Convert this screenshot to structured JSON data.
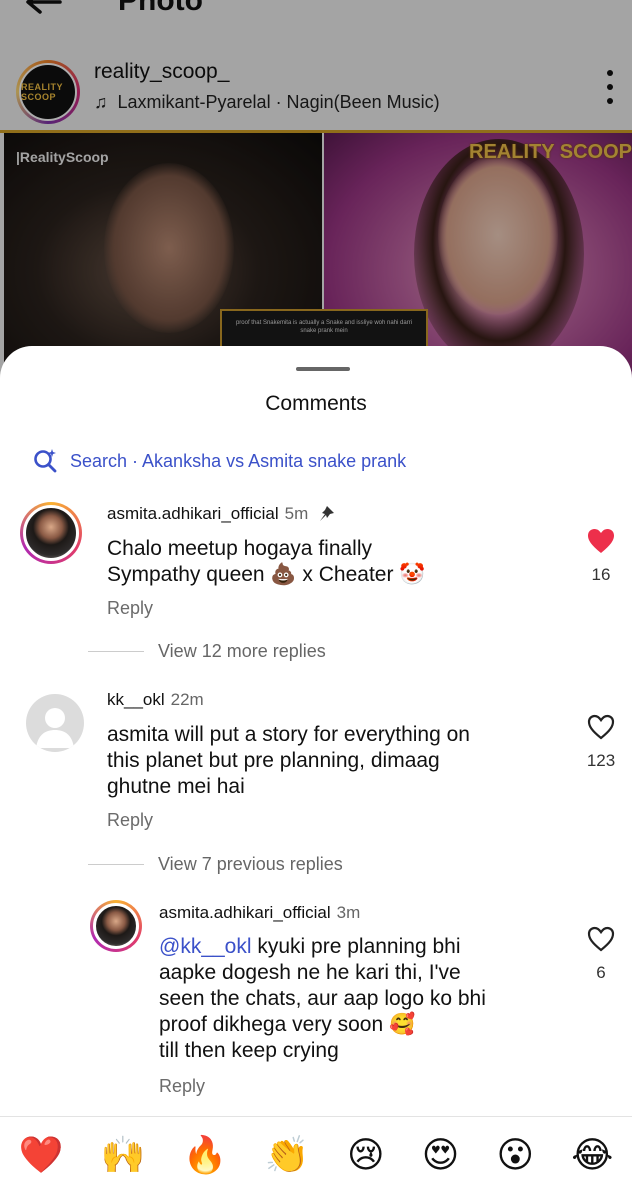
{
  "topbar": {
    "title": "Photo"
  },
  "post": {
    "username": "reality_scoop_",
    "music": "Laxmikant-Pyarelal · Nagin(Been Music)",
    "avatar_logo": "REALITY SCOOP",
    "watermark_left": "|RealityScoop",
    "watermark_right": "REALITY SCOOP",
    "caption_overlay": "proof that Snakemita is actually a Snake and issliye woh nahi darri snake prank mein"
  },
  "comments_sheet": {
    "title": "Comments",
    "search_label": "Search · Akanksha vs Asmita snake prank",
    "comments": [
      {
        "username": "asmita.adhikari_official",
        "time": "5m",
        "pinned": true,
        "text_line1": "Chalo meetup hogaya finally",
        "text_line2": "Sympathy queen 💩 x Cheater 🤡",
        "reply_label": "Reply",
        "likes": "16",
        "liked": true,
        "view_replies": "View 12 more replies"
      },
      {
        "username": "kk__okl",
        "time": "22m",
        "text_line1": "asmita will put a story for everything on",
        "text_line2": "this planet but pre planning, dimaag",
        "text_line3": "ghutne mei hai",
        "reply_label": "Reply",
        "likes": "123",
        "liked": false,
        "view_replies": "View 7 previous replies"
      }
    ],
    "reply": {
      "username": "asmita.adhikari_official",
      "time": "3m",
      "mention": "@kk__okl",
      "text_line1_rest": " kyuki pre planning bhi",
      "text_line2": "aapke dogesh ne he kari thi, I've",
      "text_line3": "seen the chats, aur aap logo ko bhi",
      "text_line4": "proof dikhega very soon 🥰",
      "text_line5": "till then keep crying",
      "reply_label": "Reply",
      "likes": "6",
      "liked": false
    },
    "quick_emojis": [
      "❤️",
      "🙌",
      "🔥",
      "👏",
      "😢",
      "😍",
      "😮",
      "😂"
    ]
  },
  "colors": {
    "accent_blue": "#3b51c9",
    "like_red": "#ed2f4b",
    "gold": "#d4a227"
  }
}
